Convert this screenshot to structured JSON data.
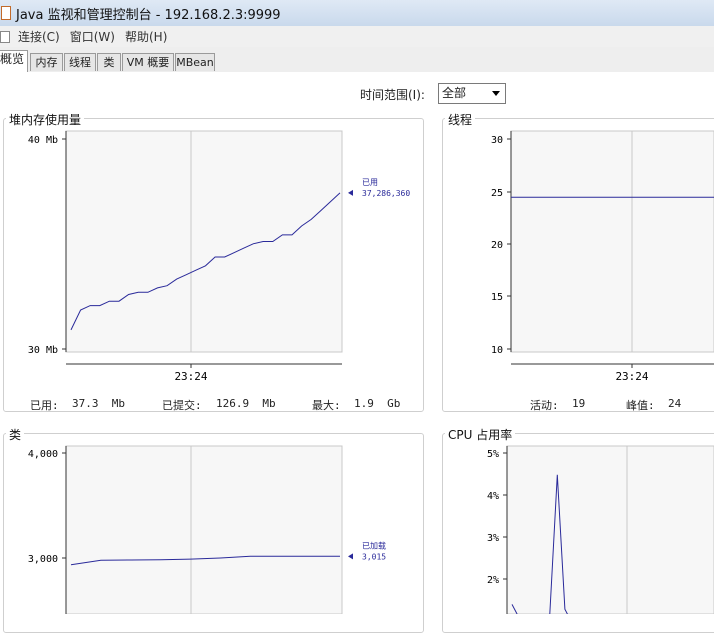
{
  "window": {
    "title": "Java 监视和管理控制台 - 192.168.2.3:9999"
  },
  "menu": {
    "items": [
      "连接(C)",
      "窗口(W)",
      "帮助(H)"
    ]
  },
  "tabs": [
    "概览",
    "内存",
    "线程",
    "类",
    "VM 概要",
    "MBean"
  ],
  "time_range": {
    "label": "时间范围(I):",
    "value": "全部"
  },
  "panels": {
    "heap": {
      "title": "堆内存使用量",
      "legend_label": "已用",
      "legend_value": "37,286,360",
      "stats": {
        "used_label": "已用:",
        "used_value": "37.3  Mb",
        "committed_label": "已提交:",
        "committed_value": "126.9  Mb",
        "max_label": "最大:",
        "max_value": "1.9  Gb"
      }
    },
    "threads": {
      "title": "线程",
      "stats": {
        "live_label": "活动:",
        "live_value": "19",
        "peak_label": "峰值:",
        "peak_value": "24"
      }
    },
    "classes": {
      "title": "类",
      "legend_label": "已加载",
      "legend_value": "3,015"
    },
    "cpu": {
      "title": "CPU 占用率"
    }
  },
  "colors": {
    "series": "#2a2a9a",
    "grid": "#c8c8c8",
    "tab_border": "#9a9a9a"
  },
  "chart_data": [
    {
      "type": "line",
      "title": "堆内存使用量",
      "x_tick_labels": [
        "23:24"
      ],
      "y_tick_labels": [
        "40 Mb",
        "30 Mb"
      ],
      "ylim": [
        30,
        40
      ],
      "series": [
        {
          "name": "已用",
          "y": [
            31.0,
            31.9,
            32.1,
            32.1,
            32.3,
            32.3,
            32.6,
            32.7,
            32.7,
            32.9,
            33.0,
            33.3,
            33.5,
            33.7,
            33.9,
            34.3,
            34.3,
            34.5,
            34.7,
            34.9,
            35.0,
            35.0,
            35.3,
            35.3,
            35.7,
            36.0,
            36.4,
            36.8,
            37.2
          ]
        }
      ]
    },
    {
      "type": "line",
      "title": "线程",
      "x_tick_labels": [
        "23:24"
      ],
      "y_tick_labels": [
        "30",
        "25",
        "20",
        "15",
        "10"
      ],
      "ylim": [
        10,
        30
      ],
      "series": [
        {
          "name": "",
          "y": [
            24,
            24
          ]
        }
      ]
    },
    {
      "type": "line",
      "title": "类",
      "y_tick_labels": [
        "4,000",
        "3,000"
      ],
      "ylim": [
        2500,
        4000
      ],
      "series": [
        {
          "name": "已加载",
          "y": [
            2940,
            2980,
            2982,
            2985,
            2990,
            3000,
            3015,
            3015,
            3015,
            3015
          ]
        }
      ]
    },
    {
      "type": "line",
      "title": "CPU 占用率",
      "y_tick_labels": [
        "5%",
        "4%",
        "3%",
        "2%"
      ],
      "ylim": [
        1.5,
        5
      ],
      "series": [
        {
          "name": "",
          "y": [
            1.7,
            1.4,
            1.3,
            1.2,
            1.3,
            1.5,
            4.4,
            1.6,
            1.3,
            1.2
          ]
        }
      ]
    }
  ]
}
